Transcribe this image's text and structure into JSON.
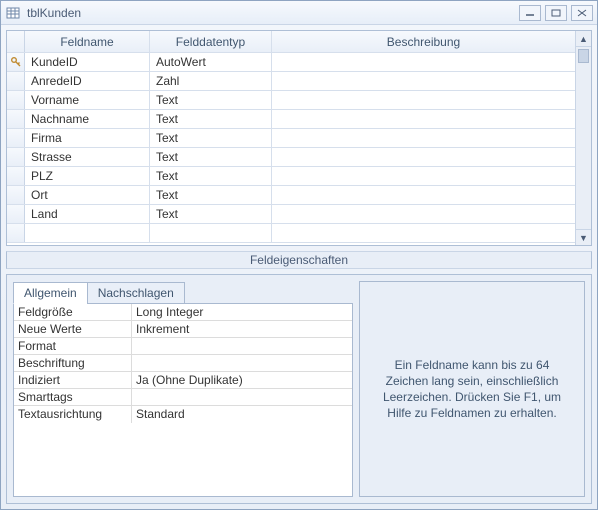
{
  "window": {
    "title": "tblKunden"
  },
  "grid": {
    "headers": {
      "fieldname": "Feldname",
      "datatype": "Felddatentyp",
      "description": "Beschreibung"
    },
    "rows": [
      {
        "pk": true,
        "name": "KundeID",
        "type": "AutoWert",
        "desc": ""
      },
      {
        "pk": false,
        "name": "AnredeID",
        "type": "Zahl",
        "desc": ""
      },
      {
        "pk": false,
        "name": "Vorname",
        "type": "Text",
        "desc": ""
      },
      {
        "pk": false,
        "name": "Nachname",
        "type": "Text",
        "desc": ""
      },
      {
        "pk": false,
        "name": "Firma",
        "type": "Text",
        "desc": ""
      },
      {
        "pk": false,
        "name": "Strasse",
        "type": "Text",
        "desc": ""
      },
      {
        "pk": false,
        "name": "PLZ",
        "type": "Text",
        "desc": ""
      },
      {
        "pk": false,
        "name": "Ort",
        "type": "Text",
        "desc": ""
      },
      {
        "pk": false,
        "name": "Land",
        "type": "Text",
        "desc": ""
      }
    ]
  },
  "propsTitle": "Feldeigenschaften",
  "tabs": {
    "general": "Allgemein",
    "lookup": "Nachschlagen"
  },
  "properties": [
    {
      "label": "Feldgröße",
      "value": "Long Integer"
    },
    {
      "label": "Neue Werte",
      "value": "Inkrement"
    },
    {
      "label": "Format",
      "value": ""
    },
    {
      "label": "Beschriftung",
      "value": ""
    },
    {
      "label": "Indiziert",
      "value": "Ja (Ohne Duplikate)"
    },
    {
      "label": "Smarttags",
      "value": ""
    },
    {
      "label": "Textausrichtung",
      "value": "Standard"
    }
  ],
  "helpText": "Ein Feldname kann bis zu 64 Zeichen lang sein, einschließlich Leerzeichen. Drücken Sie F1, um Hilfe zu Feldnamen zu erhalten."
}
